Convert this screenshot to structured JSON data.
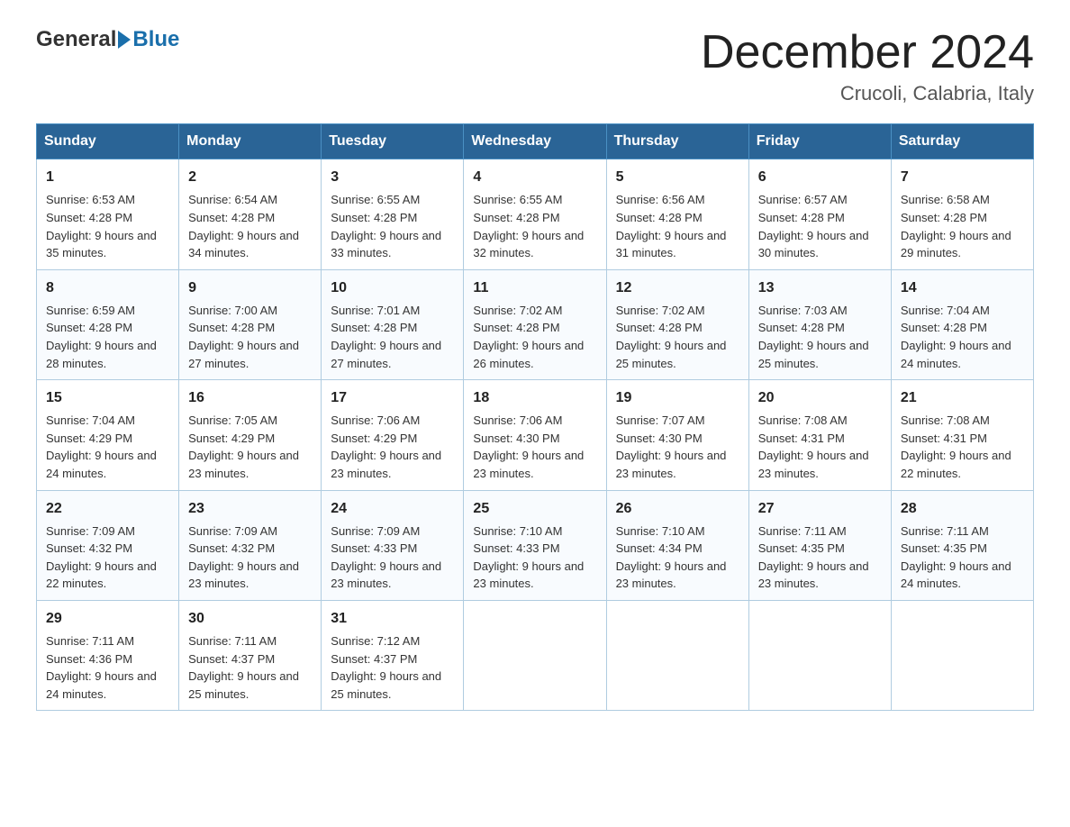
{
  "header": {
    "logo_general": "General",
    "logo_blue": "Blue",
    "month_title": "December 2024",
    "location": "Crucoli, Calabria, Italy"
  },
  "days_of_week": [
    "Sunday",
    "Monday",
    "Tuesday",
    "Wednesday",
    "Thursday",
    "Friday",
    "Saturday"
  ],
  "weeks": [
    [
      {
        "day": "1",
        "sunrise": "6:53 AM",
        "sunset": "4:28 PM",
        "daylight": "9 hours and 35 minutes."
      },
      {
        "day": "2",
        "sunrise": "6:54 AM",
        "sunset": "4:28 PM",
        "daylight": "9 hours and 34 minutes."
      },
      {
        "day": "3",
        "sunrise": "6:55 AM",
        "sunset": "4:28 PM",
        "daylight": "9 hours and 33 minutes."
      },
      {
        "day": "4",
        "sunrise": "6:55 AM",
        "sunset": "4:28 PM",
        "daylight": "9 hours and 32 minutes."
      },
      {
        "day": "5",
        "sunrise": "6:56 AM",
        "sunset": "4:28 PM",
        "daylight": "9 hours and 31 minutes."
      },
      {
        "day": "6",
        "sunrise": "6:57 AM",
        "sunset": "4:28 PM",
        "daylight": "9 hours and 30 minutes."
      },
      {
        "day": "7",
        "sunrise": "6:58 AM",
        "sunset": "4:28 PM",
        "daylight": "9 hours and 29 minutes."
      }
    ],
    [
      {
        "day": "8",
        "sunrise": "6:59 AM",
        "sunset": "4:28 PM",
        "daylight": "9 hours and 28 minutes."
      },
      {
        "day": "9",
        "sunrise": "7:00 AM",
        "sunset": "4:28 PM",
        "daylight": "9 hours and 27 minutes."
      },
      {
        "day": "10",
        "sunrise": "7:01 AM",
        "sunset": "4:28 PM",
        "daylight": "9 hours and 27 minutes."
      },
      {
        "day": "11",
        "sunrise": "7:02 AM",
        "sunset": "4:28 PM",
        "daylight": "9 hours and 26 minutes."
      },
      {
        "day": "12",
        "sunrise": "7:02 AM",
        "sunset": "4:28 PM",
        "daylight": "9 hours and 25 minutes."
      },
      {
        "day": "13",
        "sunrise": "7:03 AM",
        "sunset": "4:28 PM",
        "daylight": "9 hours and 25 minutes."
      },
      {
        "day": "14",
        "sunrise": "7:04 AM",
        "sunset": "4:28 PM",
        "daylight": "9 hours and 24 minutes."
      }
    ],
    [
      {
        "day": "15",
        "sunrise": "7:04 AM",
        "sunset": "4:29 PM",
        "daylight": "9 hours and 24 minutes."
      },
      {
        "day": "16",
        "sunrise": "7:05 AM",
        "sunset": "4:29 PM",
        "daylight": "9 hours and 23 minutes."
      },
      {
        "day": "17",
        "sunrise": "7:06 AM",
        "sunset": "4:29 PM",
        "daylight": "9 hours and 23 minutes."
      },
      {
        "day": "18",
        "sunrise": "7:06 AM",
        "sunset": "4:30 PM",
        "daylight": "9 hours and 23 minutes."
      },
      {
        "day": "19",
        "sunrise": "7:07 AM",
        "sunset": "4:30 PM",
        "daylight": "9 hours and 23 minutes."
      },
      {
        "day": "20",
        "sunrise": "7:08 AM",
        "sunset": "4:31 PM",
        "daylight": "9 hours and 23 minutes."
      },
      {
        "day": "21",
        "sunrise": "7:08 AM",
        "sunset": "4:31 PM",
        "daylight": "9 hours and 22 minutes."
      }
    ],
    [
      {
        "day": "22",
        "sunrise": "7:09 AM",
        "sunset": "4:32 PM",
        "daylight": "9 hours and 22 minutes."
      },
      {
        "day": "23",
        "sunrise": "7:09 AM",
        "sunset": "4:32 PM",
        "daylight": "9 hours and 23 minutes."
      },
      {
        "day": "24",
        "sunrise": "7:09 AM",
        "sunset": "4:33 PM",
        "daylight": "9 hours and 23 minutes."
      },
      {
        "day": "25",
        "sunrise": "7:10 AM",
        "sunset": "4:33 PM",
        "daylight": "9 hours and 23 minutes."
      },
      {
        "day": "26",
        "sunrise": "7:10 AM",
        "sunset": "4:34 PM",
        "daylight": "9 hours and 23 minutes."
      },
      {
        "day": "27",
        "sunrise": "7:11 AM",
        "sunset": "4:35 PM",
        "daylight": "9 hours and 23 minutes."
      },
      {
        "day": "28",
        "sunrise": "7:11 AM",
        "sunset": "4:35 PM",
        "daylight": "9 hours and 24 minutes."
      }
    ],
    [
      {
        "day": "29",
        "sunrise": "7:11 AM",
        "sunset": "4:36 PM",
        "daylight": "9 hours and 24 minutes."
      },
      {
        "day": "30",
        "sunrise": "7:11 AM",
        "sunset": "4:37 PM",
        "daylight": "9 hours and 25 minutes."
      },
      {
        "day": "31",
        "sunrise": "7:12 AM",
        "sunset": "4:37 PM",
        "daylight": "9 hours and 25 minutes."
      },
      null,
      null,
      null,
      null
    ]
  ]
}
